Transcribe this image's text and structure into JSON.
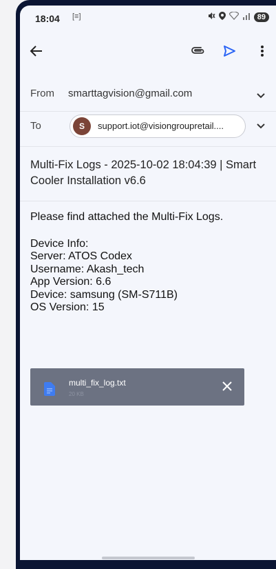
{
  "status_bar": {
    "time": "18:04",
    "battery": "89",
    "sim_icon": "[≡]"
  },
  "toolbar": {
    "back_icon": "arrow-left",
    "attach_icon": "paperclip",
    "send_icon": "send",
    "more_icon": "more-vertical",
    "send_color": "#2a64f5"
  },
  "from": {
    "label": "From",
    "value": "smarttagvision@gmail.com"
  },
  "to": {
    "label": "To",
    "avatar_letter": "S",
    "recipient": "support.iot@visiongroupretail...."
  },
  "subject": "Multi-Fix Logs - 2025-10-02 18:04:39 | Smart Cooler Installation v6.6",
  "body": {
    "intro": "Please find attached the Multi-Fix Logs.",
    "lines": [
      "Device Info:",
      "Server: ATOS Codex",
      "Username: Akash_tech",
      "App Version: 6.6",
      "Device: samsung (SM-S711B)",
      "OS Version: 15"
    ]
  },
  "attachment": {
    "filename": "multi_fix_log.txt",
    "size": "20 KB"
  }
}
